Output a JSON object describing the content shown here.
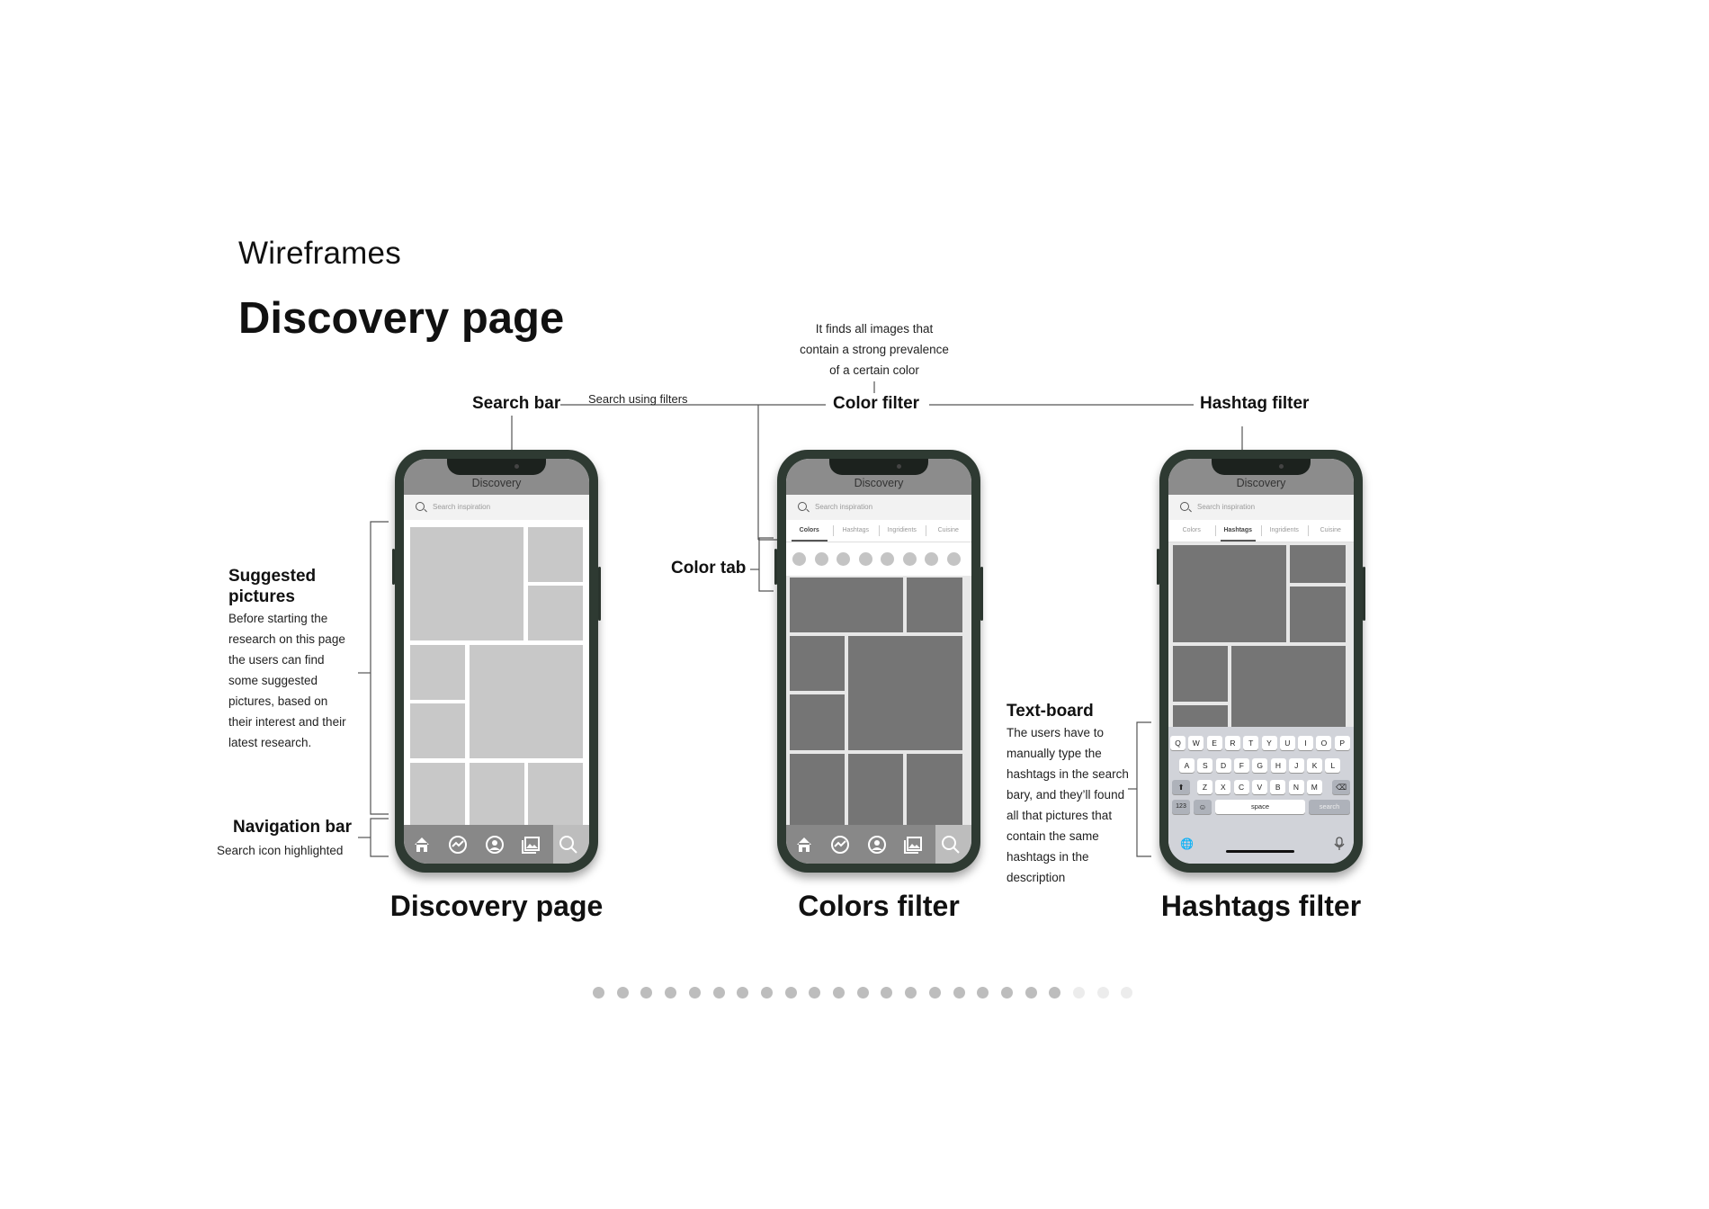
{
  "header": {
    "section": "Wireframes",
    "title": "Discovery page"
  },
  "annotations": {
    "search_bar": "Search bar",
    "search_filters": "Search using filters",
    "color_filter": "Color filter",
    "color_filter_note": [
      "It finds all images that",
      "contain a strong prevalence",
      "of a certain color"
    ],
    "hashtag_filter": "Hashtag filter",
    "color_tab": "Color tab",
    "suggested_title": [
      "Suggested",
      "pictures"
    ],
    "suggested_note": [
      "Before starting the",
      "research on this page",
      "the users can find",
      "some suggested",
      "pictures, based on",
      "their interest and their",
      "latest research."
    ],
    "navigation_bar": "Navigation bar",
    "navigation_note": "Search icon highlighted",
    "textboard_title": "Text-board",
    "textboard_note": [
      "The users have to",
      "manually type the",
      "hashtags in the search",
      "bary, and they’ll found",
      "all that pictures that",
      "contain the same",
      "hashtags in the",
      "description"
    ]
  },
  "phone": {
    "app_title": "Discovery",
    "search_placeholder": "Search inspiration",
    "tabs": [
      "Colors",
      "Hashtags",
      "Ingridients",
      "Cuisine"
    ],
    "keyboard": {
      "row1": [
        "Q",
        "W",
        "E",
        "R",
        "T",
        "Y",
        "U",
        "I",
        "O",
        "P"
      ],
      "row2": [
        "A",
        "S",
        "D",
        "F",
        "G",
        "H",
        "J",
        "K",
        "L"
      ],
      "row3": [
        "Z",
        "X",
        "C",
        "V",
        "B",
        "N",
        "M"
      ],
      "num": "123",
      "space": "space",
      "search": "search"
    }
  },
  "captions": {
    "discovery": "Discovery page",
    "colors": "Colors filter",
    "hashtags": "Hashtags filter"
  },
  "pagination": {
    "total": 23,
    "active_count": 20
  },
  "colors": {
    "tile_light": "#c8c8c8",
    "tile_dark": "#757575",
    "frame": "#2e3a32",
    "appbar": "#8c8c8c"
  }
}
